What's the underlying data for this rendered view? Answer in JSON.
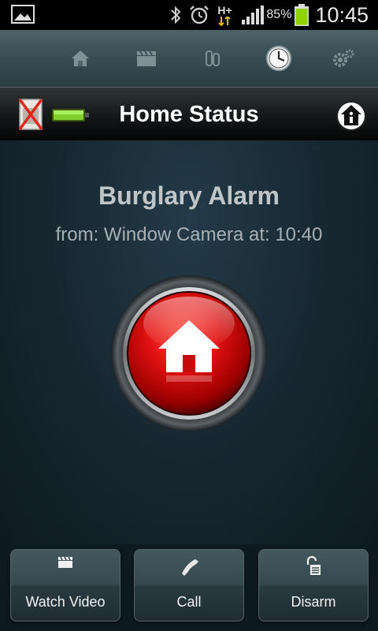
{
  "status_bar": {
    "battery_percent": "85%",
    "time": "10:45",
    "network_label": "H+",
    "icons": [
      "gallery-icon",
      "bluetooth-icon",
      "alarm-clock-icon",
      "hplus-data-icon",
      "signal-icon",
      "battery-icon"
    ]
  },
  "tabs": [
    {
      "name": "home",
      "icon": "home-icon",
      "active": false
    },
    {
      "name": "video",
      "icon": "clapperboard-icon",
      "active": false
    },
    {
      "name": "devices",
      "icon": "sensors-icon",
      "active": false
    },
    {
      "name": "history",
      "icon": "clock-icon",
      "active": true
    },
    {
      "name": "settings",
      "icon": "gears-icon",
      "active": false
    }
  ],
  "header": {
    "title": "Home Status",
    "camera_status": "camera-off-icon",
    "device_battery": "battery-full-icon",
    "info_icon": "home-info-icon"
  },
  "alarm": {
    "title": "Burglary Alarm",
    "subtitle": "from: Window Camera at: 10:40",
    "button_icon": "home-icon",
    "color": "#d40000"
  },
  "actions": [
    {
      "label": "Watch Video",
      "icon": "clapperboard-icon"
    },
    {
      "label": "Call",
      "icon": "phone-icon"
    },
    {
      "label": "Disarm",
      "icon": "unlock-icon"
    }
  ]
}
